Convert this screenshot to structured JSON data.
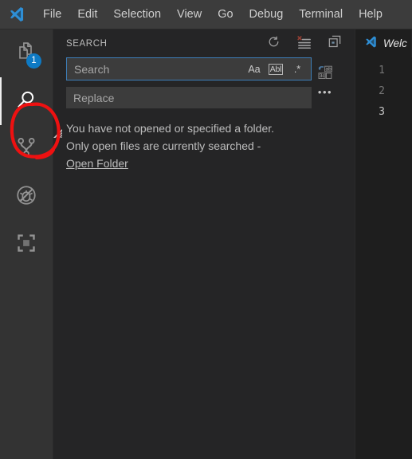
{
  "window": {
    "logo_icon": "vscode-logo-icon",
    "menu": [
      {
        "label": "File"
      },
      {
        "label": "Edit"
      },
      {
        "label": "Selection"
      },
      {
        "label": "View"
      },
      {
        "label": "Go"
      },
      {
        "label": "Debug"
      },
      {
        "label": "Terminal"
      },
      {
        "label": "Help"
      }
    ]
  },
  "activity_bar": {
    "items": [
      {
        "name": "explorer",
        "icon": "files-icon",
        "badge": "1",
        "active": false
      },
      {
        "name": "search",
        "icon": "search-icon",
        "badge": "",
        "active": true
      },
      {
        "name": "source-control",
        "icon": "source-control-icon",
        "badge": "",
        "active": false
      },
      {
        "name": "debug",
        "icon": "debug-no-icon",
        "badge": "",
        "active": false
      },
      {
        "name": "extensions",
        "icon": "extensions-icon",
        "badge": "",
        "active": false
      }
    ],
    "annotation": {
      "shape": "hand-drawn-circle",
      "color": "#ee1111",
      "targets": "search-icon"
    }
  },
  "sidebar": {
    "title": "SEARCH",
    "actions": [
      {
        "name": "refresh",
        "icon": "refresh-icon"
      },
      {
        "name": "clear-search-results",
        "icon": "clear-all-icon"
      },
      {
        "name": "open-new-search-editor",
        "icon": "new-search-editor-icon"
      }
    ],
    "search_field": {
      "value": "",
      "placeholder": "Search",
      "focused": true,
      "toggles": [
        {
          "name": "match-case",
          "label": "Aa"
        },
        {
          "name": "match-whole-word",
          "label": "Abl",
          "boxed": true
        },
        {
          "name": "use-regex",
          "label": ".*"
        }
      ]
    },
    "replace_field": {
      "value": "",
      "placeholder": "Replace",
      "toggles": []
    },
    "replace_all_button": {
      "name": "replace-all",
      "icon": "replace-all-icon"
    },
    "more_button": {
      "name": "toggle-search-details",
      "label": "•••"
    },
    "message": {
      "line1": "You have not opened or specified a folder.",
      "line2": "Only open files are currently searched -",
      "link": "Open Folder"
    }
  },
  "editor": {
    "tabs": [
      {
        "label": "Welc",
        "icon": "vscode-logo-icon",
        "active": true,
        "italic": true
      }
    ],
    "line_numbers": [
      "1",
      "2",
      "3"
    ],
    "active_line": "3",
    "content": ""
  },
  "colors": {
    "titlebar_bg": "#3c3c3c",
    "activitybar_bg": "#333333",
    "sidebar_bg": "#252526",
    "editor_bg": "#1e1e1e",
    "input_bg": "#3c3c3c",
    "accent_blue": "#0e7ac4",
    "focus_border": "#3d7eb8",
    "annotation_red": "#ee1111",
    "text": "#cccccc"
  }
}
